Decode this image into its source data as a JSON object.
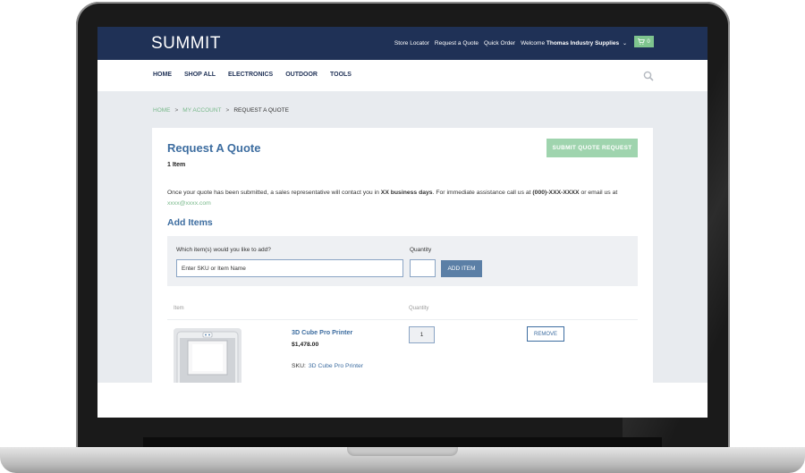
{
  "header": {
    "logo": "SUMMIT",
    "links": [
      "Store Locator",
      "Request a Quote",
      "Quick Order"
    ],
    "welcome_prefix": "Welcome",
    "account_name": "Thomas Industry Supplies",
    "cart_count": "0"
  },
  "nav": {
    "items": [
      "HOME",
      "SHOP ALL",
      "ELECTRONICS",
      "OUTDOOR",
      "TOOLS"
    ]
  },
  "breadcrumb": {
    "home": "HOME",
    "account": "MY ACCOUNT",
    "current": "REQUEST A QUOTE",
    "separator": ">"
  },
  "quote": {
    "title": "Request A Quote",
    "item_count": "1 Item",
    "submit_label": "SUBMIT QUOTE REQUEST",
    "notice_part1": "Once your quote has been submitted, a sales representative will contact you in ",
    "notice_bold1": "XX business days",
    "notice_part2": ". For immediate assistance call us at ",
    "notice_bold2": "(000)-XXX-XXXX",
    "notice_part3": " or email us at ",
    "notice_email": "xxxx@xxxx.com"
  },
  "add_items": {
    "title": "Add Items",
    "item_label": "Which item(s) would you like to add?",
    "quantity_label": "Quantity",
    "sku_placeholder": "Enter SKU or Item Name",
    "add_button": "ADD ITEM"
  },
  "table": {
    "col_item": "Item",
    "col_quantity": "Quantity",
    "rows": [
      {
        "name": "3D Cube Pro Printer",
        "price": "$1,478.00",
        "sku_label": "SKU:",
        "sku": "3D Cube Pro Printer",
        "quantity": "1",
        "remove_label": "REMOVE"
      }
    ]
  },
  "colors": {
    "header_bg": "#1f3156",
    "accent_green": "#79b98b",
    "title_blue": "#3d6da0",
    "button_blue": "#5b7fa6"
  }
}
